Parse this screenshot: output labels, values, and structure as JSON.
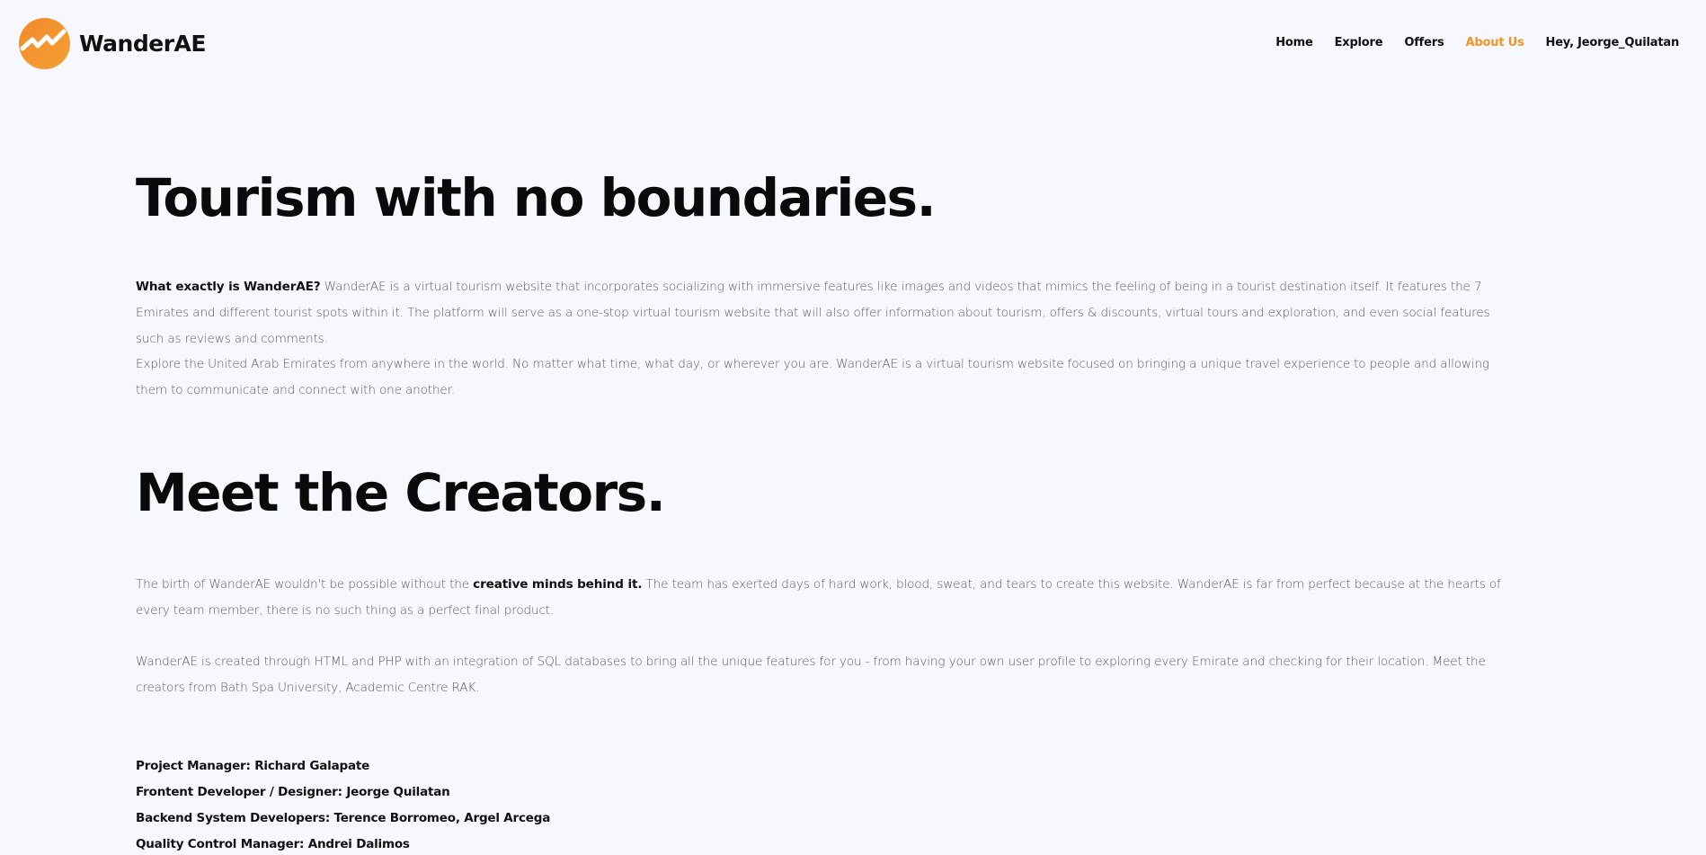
{
  "brand": {
    "name": "WanderAE",
    "logo_icon": "wave-arrow-logo",
    "accent_color": "#f2932a"
  },
  "nav": {
    "items": [
      {
        "label": "Home",
        "active": false
      },
      {
        "label": "Explore",
        "active": false
      },
      {
        "label": "Offers",
        "active": false
      },
      {
        "label": "About Us",
        "active": true
      },
      {
        "label": "Hey, Jeorge_Quilatan",
        "active": false
      }
    ]
  },
  "about": {
    "heading": "Tourism with no boundaries.",
    "p1_lead": "What exactly is WanderAE?",
    "p1_body": " WanderAE is a virtual tourism website that incorporates socializing with immersive features like images and videos that mimics the feeling of being in a tourist destination itself. It features the 7 Emirates and different tourist spots within it. The platform will serve as a one-stop virtual tourism website that will also offer information about tourism, offers & discounts, virtual tours and exploration, and even social features such as reviews and comments.",
    "p2": "Explore the United Arab Emirates from anywhere in the world. No matter what time, what day, or wherever you are. WanderAE is a virtual tourism website focused on bringing a unique travel experience to people and allowing them to communicate and connect with one another."
  },
  "creators": {
    "heading": "Meet the Creators.",
    "p1_pre": "The birth of WanderAE wouldn't be possible without the ",
    "p1_bold": "creative minds behind it.",
    "p1_post": " The team has exerted days of hard work, blood, sweat, and tears to create this website. WanderAE is far from perfect because at the hearts of every team member, there is no such thing as a perfect final product.",
    "p2": "WanderAE is created through HTML and PHP with an integration of SQL databases to bring all the unique features for you - from having your own user profile to exploring every Emirate and checking for their location. Meet the creators from Bath Spa University, Academic Centre RAK.",
    "team": [
      "Project Manager: Richard Galapate",
      "Frontent Developer / Designer: Jeorge Quilatan",
      "Backend System Developers: Terence Borromeo, Argel Arcega",
      "Quality Control Manager: Andrei Dalimos"
    ]
  }
}
